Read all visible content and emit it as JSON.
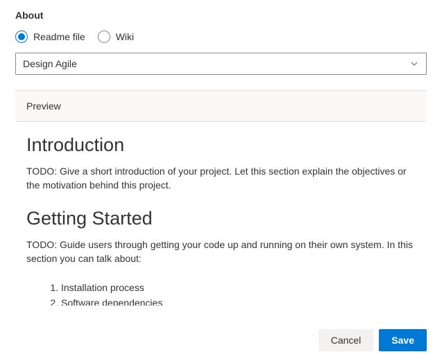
{
  "header": {
    "title": "About"
  },
  "radios": {
    "readme": {
      "label": "Readme file",
      "selected": true
    },
    "wiki": {
      "label": "Wiki",
      "selected": false
    }
  },
  "dropdown": {
    "value": "Design Agile"
  },
  "preview": {
    "tab": "Preview",
    "h1a": "Introduction",
    "p1": "TODO: Give a short introduction of your project. Let this section explain the objectives or the motivation behind this project.",
    "h1b": "Getting Started",
    "p2": "TODO: Guide users through getting your code up and running on their own system. In this section you can talk about:",
    "li1": "Installation process",
    "li2": "Software dependencies"
  },
  "footer": {
    "cancel": "Cancel",
    "save": "Save"
  }
}
